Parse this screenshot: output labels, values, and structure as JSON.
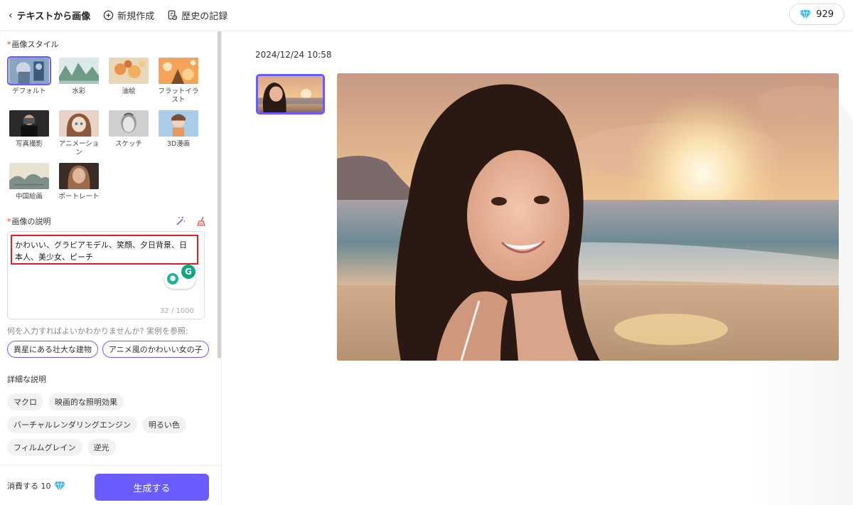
{
  "header": {
    "back_label": "テキストから画像",
    "new_label": "新規作成",
    "history_label": "歴史の記録",
    "credits": "929"
  },
  "style_section": {
    "label": "画像スタイル",
    "required_mark": "*",
    "styles": [
      {
        "label": "デフォルト",
        "selected": true
      },
      {
        "label": "水彩",
        "selected": false
      },
      {
        "label": "油絵",
        "selected": false
      },
      {
        "label": "フラットイラスト",
        "selected": false
      },
      {
        "label": "写真撮影",
        "selected": false
      },
      {
        "label": "アニメーション",
        "selected": false
      },
      {
        "label": "スケッチ",
        "selected": false
      },
      {
        "label": "3D漫画",
        "selected": false
      },
      {
        "label": "中国絵画",
        "selected": false
      },
      {
        "label": "ポートレート",
        "selected": false
      }
    ]
  },
  "description": {
    "label": "画像の説明",
    "required_mark": "*",
    "value": "かわいい、グラビアモデル、笑顔、夕日背景、日本人、美少女、ピーチ",
    "count": "32 / 1000",
    "hint": "何を入力すればよいかわかりませんか? 実例を参照:",
    "examples": [
      "異星にある壮大な建物",
      "アニメ風のかわいい女の子"
    ]
  },
  "detail": {
    "label": "詳細な説明",
    "tags": [
      "マクロ",
      "映画的な照明効果",
      "バーチャルレンダリングエンジン",
      "明るい色",
      "フィルムグレイン",
      "逆光"
    ]
  },
  "footer": {
    "cost_label": "消費する 10",
    "generate_label": "生成する"
  },
  "result": {
    "timestamp": "2024/12/24 10:58"
  },
  "colors": {
    "accent": "#6a5cff",
    "highlight_box": "#e02020",
    "diamond": "#3fb6f0"
  }
}
